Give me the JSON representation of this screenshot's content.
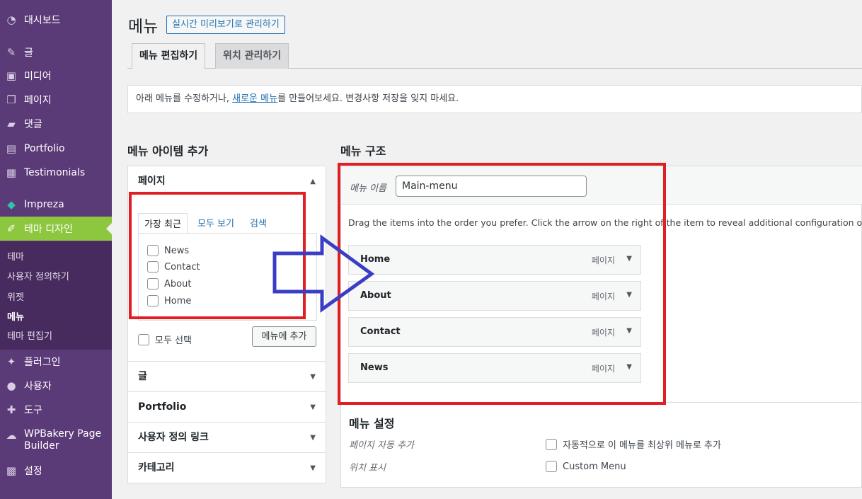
{
  "sidebar": {
    "items": [
      {
        "label": "대시보드",
        "icon": "dashboard-icon"
      },
      {
        "label": "글",
        "icon": "pin-icon"
      },
      {
        "label": "미디어",
        "icon": "media-icon"
      },
      {
        "label": "페이지",
        "icon": "pages-icon"
      },
      {
        "label": "댓글",
        "icon": "comments-icon"
      },
      {
        "label": "Portfolio",
        "icon": "portfolio-icon"
      },
      {
        "label": "Testimonials",
        "icon": "testimonials-icon"
      },
      {
        "label": "Impreza",
        "icon": "diamond-icon"
      },
      {
        "label": "테마 디자인",
        "icon": "brush-icon"
      },
      {
        "label": "플러그인",
        "icon": "plugin-icon"
      },
      {
        "label": "사용자",
        "icon": "user-icon"
      },
      {
        "label": "도구",
        "icon": "wrench-icon"
      },
      {
        "label": "WPBakery Page Builder",
        "icon": "cloud-icon"
      },
      {
        "label": "설정",
        "icon": "settings-icon"
      }
    ],
    "submenu": [
      "테마",
      "사용자 정의하기",
      "위젯",
      "메뉴",
      "테마 편집기"
    ]
  },
  "header": {
    "title": "메뉴",
    "preview_button": "실시간 미리보기로 관리하기",
    "tabs": [
      "메뉴 편집하기",
      "위치 관리하기"
    ]
  },
  "notice": {
    "before": "아래 메뉴를 수정하거나, ",
    "link": "새로운 메뉴",
    "after": "를 만들어보세요. 변경사항 저장을 잊지 마세요."
  },
  "add_items": {
    "title": "메뉴 아이템 추가",
    "pages_section": "페이지",
    "inner_tabs": [
      "가장 최근",
      "모두 보기",
      "검색"
    ],
    "pages": [
      "News",
      "Contact",
      "About",
      "Home"
    ],
    "select_all": "모두 선택",
    "add_button": "메뉴에 추가",
    "sections": [
      "글",
      "Portfolio",
      "사용자 정의 링크",
      "카테고리"
    ]
  },
  "structure": {
    "title": "메뉴 구조",
    "name_label": "메뉴 이름",
    "name_value": "Main-menu",
    "instructions": "Drag the items into the order you prefer. Click the arrow on the right of the item to reveal additional configuration options.",
    "items": [
      {
        "title": "Home",
        "type": "페이지"
      },
      {
        "title": "About",
        "type": "페이지"
      },
      {
        "title": "Contact",
        "type": "페이지"
      },
      {
        "title": "News",
        "type": "페이지"
      }
    ],
    "settings_title": "메뉴 설정",
    "auto_add_label": "페이지 자동 추가",
    "auto_add_option": "자동적으로 이 메뉴를 최상위 메뉴로 추가",
    "location_label": "위치 표시",
    "location_option": "Custom Menu"
  },
  "colors": {
    "sidebar": "#5b3a78",
    "active": "#8dc63f",
    "link": "#2271b1",
    "highlight_box": "#e01e24",
    "arrow": "#3a3ec4"
  }
}
